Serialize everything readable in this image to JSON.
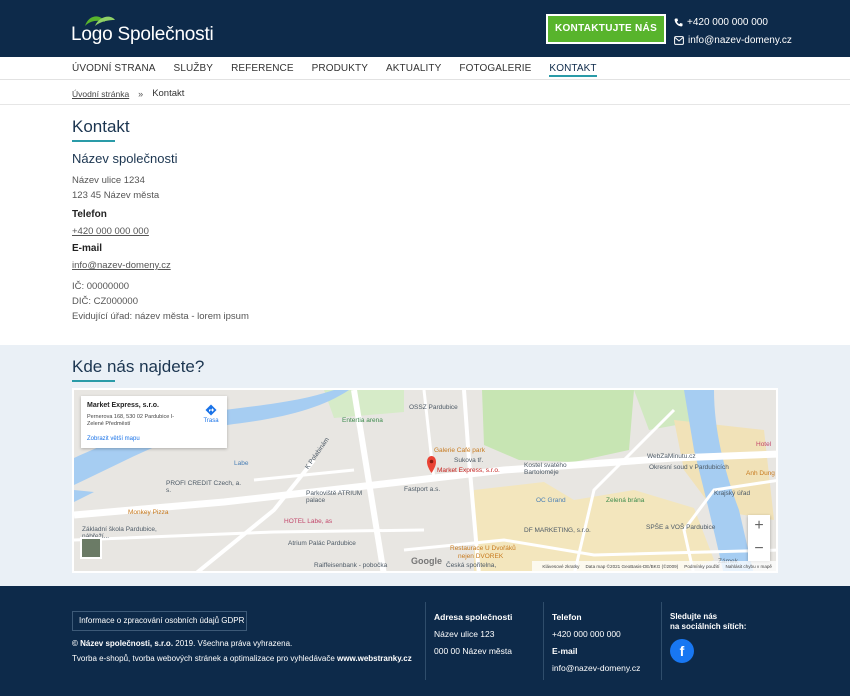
{
  "header": {
    "logo_text": "Logo Společnosti",
    "cta_label": "Kontaktujte nás",
    "phone": "+420 000 000 000",
    "email": "info@nazev-domeny.cz"
  },
  "nav": {
    "items": [
      {
        "label": "Úvodní strana"
      },
      {
        "label": "Služby"
      },
      {
        "label": "Reference"
      },
      {
        "label": "Produkty"
      },
      {
        "label": "Aktuality"
      },
      {
        "label": "Fotogalerie"
      },
      {
        "label": "Kontakt"
      }
    ],
    "active_index": 6
  },
  "breadcrumb": {
    "home": "Úvodní stránka",
    "separator": "»",
    "current": "Kontakt"
  },
  "contact": {
    "title": "Kontakt",
    "company": "Název společnosti",
    "street": "Název ulice 1234",
    "city": "123 45 Název města",
    "phone_label": "Telefon",
    "phone": "+420 000 000 000",
    "email_label": "E-mail",
    "email": "info@nazev-domeny.cz",
    "ic": "IČ: 00000000",
    "dic": "DIČ: CZ000000",
    "office": "Evidující úřad: název města - lorem ipsum"
  },
  "map_section": {
    "title": "Kde nás najdete?",
    "card": {
      "name": "Market Express, s.r.o.",
      "address": "Pernerova 168, 530 02 Pardubice I-Zelené Předměstí",
      "route": "Trasa",
      "bigger_map": "Zobrazit větší mapu"
    },
    "labels": {
      "entertia": "Entertia arena",
      "ossz": "OSSZ Pardubice",
      "labe": "Labe",
      "galerie": "Galerie Café park",
      "sukova": "Sukova tř.",
      "kostel": "Kostel svatého Bartoloměje",
      "webzaminutu": "WebZaMinutu.cz",
      "okresni": "Okresní soud v Pardubicích",
      "hotel": "Hotel",
      "anh_dung": "Anh Dung",
      "market": "Market Express, s.r.o.",
      "profi_credit": "PROFI CREDIT Czech, a. s.",
      "fastport": "Fastport a.s.",
      "parkoviste": "Parkoviště ATRIUM palace",
      "oc_grand": "OC Grand",
      "zelena_brana": "Zelená brána",
      "krajsky": "Krajský úřad",
      "monkey": "Monkey Pizza",
      "hotel_labe": "HOTEL Labe, as",
      "df": "DF MARKETING, s.r.o.",
      "spse": "SPŠE a VOŠ Pardubice",
      "skola": "Základní škola Pardubice, nábřeží...",
      "atrium": "Atrium Palác Pardubice",
      "restaurace": "Restaurace U Dvořáků",
      "nejen": "nejen DVOREK",
      "raiffeisen": "Raiffeisenbank - pobočka",
      "ceska": "Česká spořitelna,",
      "zamek": "Zámek",
      "palackeho": "K Polabinám"
    },
    "zoom_in": "+",
    "zoom_out": "−",
    "google": "Google",
    "footer": {
      "shortcuts": "Klávesové zkratky",
      "data": "Data map ©2021 GeoBasis-DE/BKG (©2009)",
      "terms": "Podmínky použití",
      "report": "Nahlásit chybu v mapě"
    }
  },
  "footer": {
    "gdpr": "Informace o zpracování osobních údajů GDPR",
    "copyright_company": "© Název společnosti, s.r.o.",
    "copyright_rest": " 2019. Všechna práva vyhrazena.",
    "tagline_prefix": "Tvorba e-shopů, tvorba webových stránek a optimalizace pro vyhledávače ",
    "tagline_link": "www.webstranky.cz",
    "address_title": "Adresa společnosti",
    "address_street": "Název ulice 123",
    "address_city": "000 00 Název města",
    "phone_title": "Telefon",
    "phone": "+420 000 000 000",
    "email_title": "E-mail",
    "email": "info@nazev-domeny.cz",
    "social_title_1": "Sledujte nás",
    "social_title_2": "na sociálních sítích:"
  },
  "colors": {
    "navy": "#0d2a4a",
    "green": "#58b42c",
    "teal": "#2a9ba8",
    "map_bg": "#eaf0f6"
  }
}
